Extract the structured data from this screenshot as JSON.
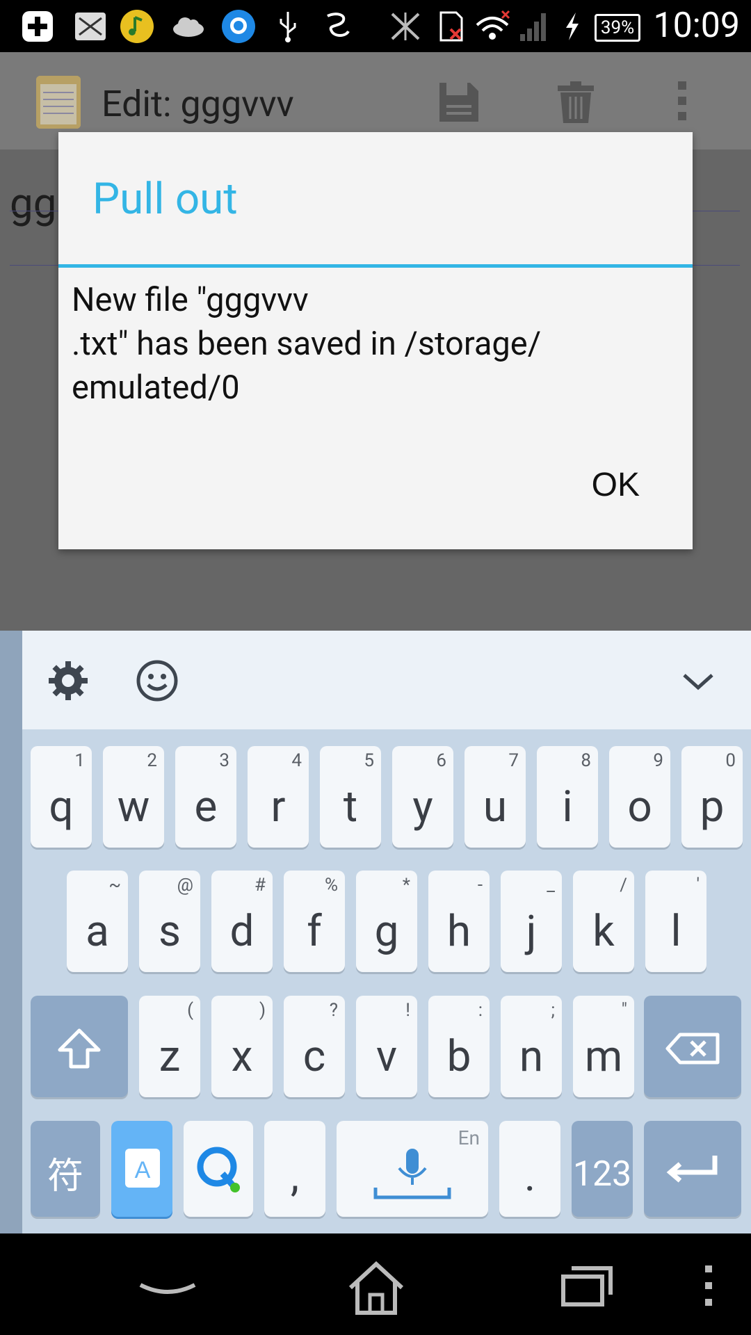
{
  "status_bar": {
    "time": "10:09",
    "battery": "39%",
    "icons": [
      "plus-icon",
      "mail-icon",
      "music-icon",
      "cloud-icon",
      "q-browser-icon",
      "usb-icon",
      "input-method-icon",
      "signal-blocked-icon",
      "sd-error-icon",
      "wifi-error-icon",
      "cellular-signal-icon",
      "charging-icon",
      "battery-icon"
    ]
  },
  "app_bar": {
    "title": "Edit: gggvvv",
    "icons": [
      "notepad-icon",
      "save-icon",
      "delete-icon",
      "more-vert-icon"
    ]
  },
  "editor": {
    "visible_text": "gg"
  },
  "dialog": {
    "title": "Pull out",
    "message": "New file \"gggvvv\n.txt\" has been saved in /storage/\nemulated/0",
    "ok_label": "OK"
  },
  "keyboard": {
    "toolbar_icons": [
      "settings-icon",
      "emoji-icon",
      "collapse-chevron-icon"
    ],
    "row1": [
      {
        "key": "q",
        "sub": "1"
      },
      {
        "key": "w",
        "sub": "2"
      },
      {
        "key": "e",
        "sub": "3"
      },
      {
        "key": "r",
        "sub": "4"
      },
      {
        "key": "t",
        "sub": "5"
      },
      {
        "key": "y",
        "sub": "6"
      },
      {
        "key": "u",
        "sub": "7"
      },
      {
        "key": "i",
        "sub": "8"
      },
      {
        "key": "o",
        "sub": "9"
      },
      {
        "key": "p",
        "sub": "0"
      }
    ],
    "row2": [
      {
        "key": "a",
        "sub": "~"
      },
      {
        "key": "s",
        "sub": "@"
      },
      {
        "key": "d",
        "sub": "#"
      },
      {
        "key": "f",
        "sub": "%"
      },
      {
        "key": "g",
        "sub": "*"
      },
      {
        "key": "h",
        "sub": "-"
      },
      {
        "key": "j",
        "sub": "_"
      },
      {
        "key": "k",
        "sub": "/"
      },
      {
        "key": "l",
        "sub": "'"
      }
    ],
    "row3": [
      {
        "key": "z",
        "sub": "("
      },
      {
        "key": "x",
        "sub": ")"
      },
      {
        "key": "c",
        "sub": "?"
      },
      {
        "key": "v",
        "sub": "!"
      },
      {
        "key": "b",
        "sub": ":"
      },
      {
        "key": "n",
        "sub": ";"
      },
      {
        "key": "m",
        "sub": "\""
      }
    ],
    "symbols_key": "符",
    "comma_key": ",",
    "space_lang": "En",
    "period_key": ".",
    "numbers_key": "123"
  },
  "nav_bar": {
    "icons": [
      "back-icon",
      "home-icon",
      "recents-icon",
      "menu-icon"
    ]
  }
}
